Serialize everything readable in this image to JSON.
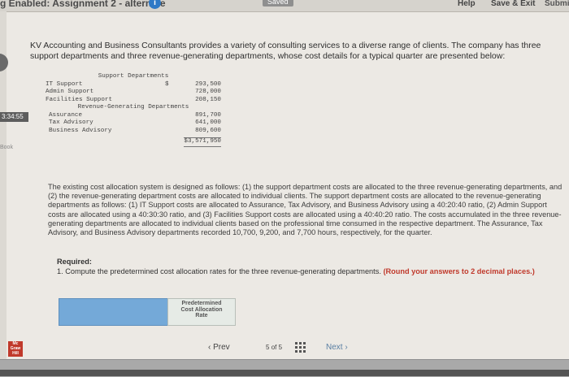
{
  "header": {
    "title": "g Enabled: Assignment 2 - alternate",
    "info_badge": "i",
    "status": "Saved",
    "help": "Help",
    "save_exit": "Save & Exit",
    "submit": "Submi"
  },
  "sidebar": {
    "timer": "3:34:55",
    "ebook": "Book"
  },
  "question": {
    "intro": "KV Accounting and Business Consultants provides a variety of consulting services to a diverse range of clients. The company has three support departments and three revenue-generating departments, whose cost details for a typical quarter are presented below:",
    "cost_table": {
      "support_heading": "Support Departments",
      "revenue_heading": "Revenue-Generating Departments",
      "currency": "$",
      "support_rows": [
        {
          "label": "IT Support",
          "value": "293,500"
        },
        {
          "label": "Admin Support",
          "value": "728,000"
        },
        {
          "label": "Facilities Support",
          "value": "208,150"
        }
      ],
      "revenue_rows": [
        {
          "label": "Assurance",
          "value": "891,700"
        },
        {
          "label": "Tax Advisory",
          "value": "641,000"
        },
        {
          "label": "Business Advisory",
          "value": "809,600"
        }
      ],
      "total": "$3,571,950"
    },
    "body": "The existing cost allocation system is designed as follows: (1) the support department costs are allocated to the three revenue-generating departments, and (2) the revenue-generating department costs are allocated to individual clients. The support department costs are allocated to the revenue-generating departments as follows: (1) IT Support costs are allocated to Assurance, Tax Advisory, and Business Advisory using a 40:20:40 ratio, (2) Admin Support costs are allocated using a 40:30:30 ratio, and (3) Facilities Support costs are allocated using a 40:40:20 ratio. The costs accumulated in the three revenue-generating departments are allocated to individual clients based on the professional time consumed in the respective department. The Assurance, Tax Advisory, and Business Advisory departments recorded 10,700, 9,200, and 7,700 hours, respectively, for the quarter.",
    "required_title": "Required:",
    "required_item": "1. Compute the predetermined cost allocation rates for the three revenue-generating departments.",
    "round_note": "(Round your answers to 2 decimal places.)",
    "answer_header": [
      "Predetermined",
      "Cost Allocation",
      "Rate"
    ]
  },
  "footer": {
    "logo": [
      "Mc",
      "Graw",
      "Hill"
    ],
    "prev": "Prev",
    "page_current": "5",
    "page_of": "of",
    "page_total": "5",
    "next": "Next"
  },
  "colors": {
    "accent_blue": "#74a9d8",
    "info_blue": "#2f79c6",
    "logo_red": "#c0392b",
    "round_note_red": "#c0392b"
  }
}
